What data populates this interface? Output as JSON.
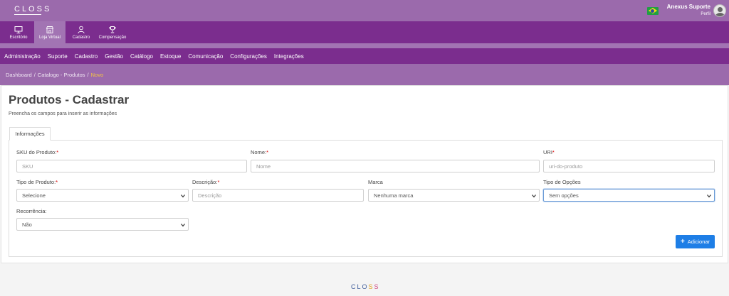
{
  "brand": {
    "logo_text": "CLOSS",
    "footer_letters": [
      "C",
      "L",
      "O",
      "S",
      "S"
    ],
    "footer_colors": [
      "#3c5a99",
      "#3c5a99",
      "#3c5a99",
      "#e0a020",
      "#d04a80"
    ]
  },
  "user": {
    "name": "Anexus Suporte",
    "role": "Perfil"
  },
  "modules": [
    {
      "label": "Escritório",
      "icon": "monitor-icon"
    },
    {
      "label": "Loja Virtual",
      "icon": "store-icon"
    },
    {
      "label": "Cadastro",
      "icon": "user-icon"
    },
    {
      "label": "Compensação",
      "icon": "trophy-icon"
    }
  ],
  "nav": [
    "Administração",
    "Suporte",
    "Cadastro",
    "Gestão",
    "Catálogo",
    "Estoque",
    "Comunicação",
    "Configurações",
    "Integrações"
  ],
  "breadcrumb": {
    "items": [
      "Dashboard",
      "Catalogo - Produtos"
    ],
    "current": "Novo"
  },
  "page": {
    "title": "Produtos - Cadastrar",
    "subtitle": "Preencha os campos para inserir as informações"
  },
  "tab": {
    "label": "Informações"
  },
  "form": {
    "sku": {
      "label": "SKU do Produto:",
      "placeholder": "SKU"
    },
    "nome": {
      "label": "Nome:",
      "placeholder": "Nome"
    },
    "uri": {
      "label": "URI",
      "placeholder": "uri-do-produto"
    },
    "tipo": {
      "label": "Tipo de Produto:",
      "value": "Selecione"
    },
    "descricao": {
      "label": "Descrição:",
      "placeholder": "Descrição"
    },
    "marca": {
      "label": "Marca",
      "value": "Nenhuma marca"
    },
    "opcoes": {
      "label": "Tipo de Opções",
      "value": "Sem opções"
    },
    "recorrencia": {
      "label": "Recorrência:",
      "value": "Não"
    },
    "required_mark": "*"
  },
  "actions": {
    "add_label": "Adicionar"
  },
  "colors": {
    "header": "#9b6aac",
    "modules_bg": "#7b2d8e",
    "accent_button": "#1e7ee6",
    "breadcrumb_current": "#f5c542"
  }
}
